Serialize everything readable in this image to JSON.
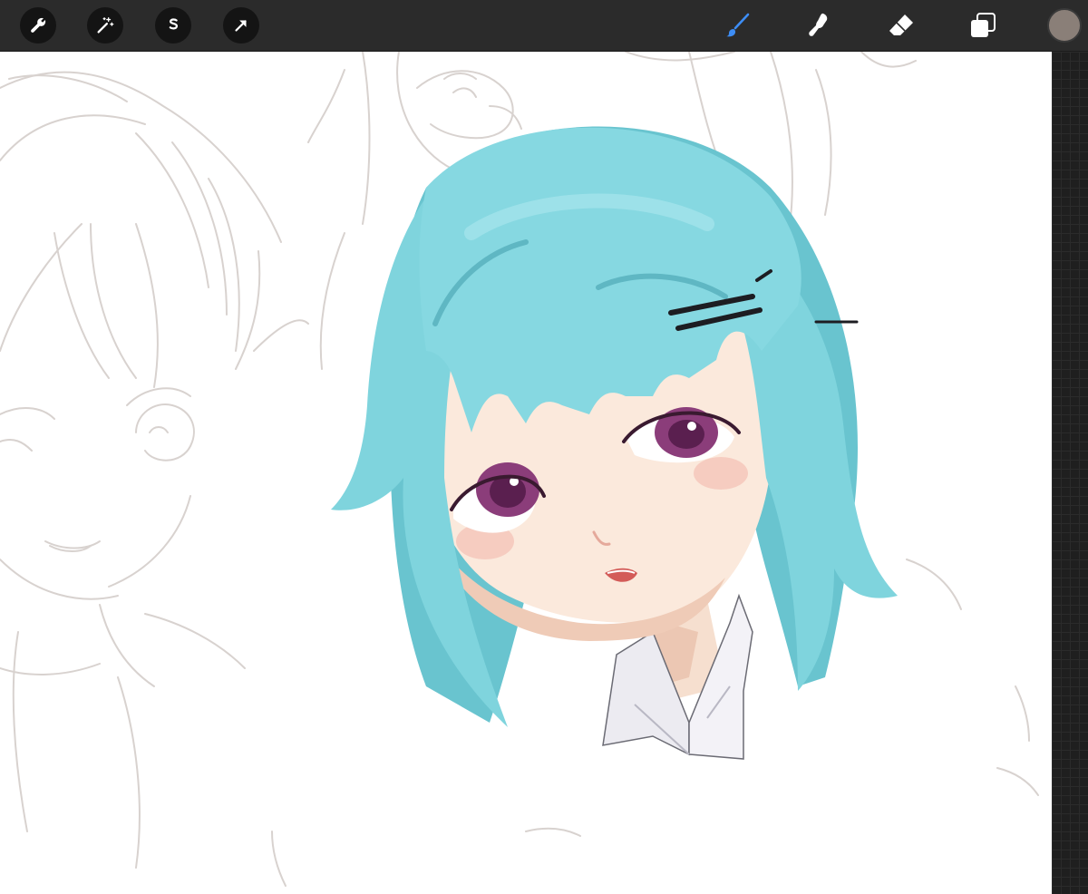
{
  "toolbar": {
    "left_tools": [
      {
        "name": "actions",
        "icon": "wrench-icon"
      },
      {
        "name": "adjustments",
        "icon": "magic-wand-icon"
      },
      {
        "name": "selection",
        "icon": "selection-s-icon"
      },
      {
        "name": "transform",
        "icon": "arrow-cursor-icon"
      }
    ],
    "right_tools": [
      {
        "name": "brush",
        "icon": "brush-icon",
        "active": true
      },
      {
        "name": "smudge",
        "icon": "smudge-finger-icon",
        "active": false
      },
      {
        "name": "eraser",
        "icon": "eraser-icon",
        "active": false
      },
      {
        "name": "layers",
        "icon": "layers-icon",
        "active": false
      }
    ],
    "current_color": "#8a7f78"
  },
  "colors": {
    "toolbar_bg": "#2b2b2b",
    "active_tool": "#3d8df5",
    "inactive_tool": "#ffffff",
    "hair": "#7fd4dd",
    "eyes": "#8b3d7a"
  }
}
